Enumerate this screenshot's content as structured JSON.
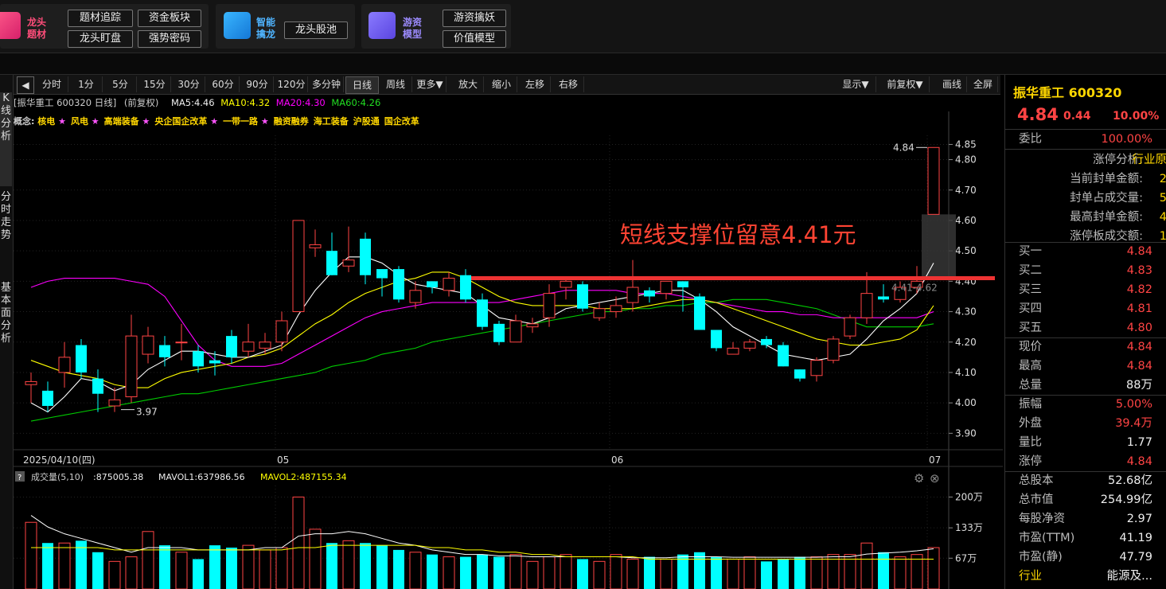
{
  "promo": {
    "g1": {
      "title1": "龙头",
      "title2": "题材",
      "buttons": [
        "题材追踪",
        "资金板块",
        "龙头盯盘",
        "强势密码"
      ]
    },
    "g2": {
      "title1": "智能",
      "title2": "擒龙",
      "buttons": [
        "龙头股池"
      ]
    },
    "g3": {
      "title1": "游资",
      "title2": "模型",
      "buttons": [
        "游资擒妖",
        "价值模型"
      ]
    }
  },
  "left_tabs": [
    "K线分析",
    "分时走势",
    "基本面分析"
  ],
  "toolbar": {
    "periods": [
      "分时",
      "1分",
      "5分",
      "15分",
      "30分",
      "60分",
      "90分",
      "120分",
      "多分钟",
      "日线",
      "周线",
      "更多▼"
    ],
    "active": "日线",
    "actions": [
      "放大",
      "缩小",
      "左移",
      "右移"
    ],
    "right": [
      "显示▼",
      "前复权▼",
      "画线",
      "全屏"
    ]
  },
  "info": {
    "stock": "[振华重工 600320 日线]",
    "adjust": "(前复权)",
    "ma5": "MA5:4.46",
    "ma10": "MA10:4.32",
    "ma20": "MA20:4.30",
    "ma60": "MA60:4.26"
  },
  "concept_label": "概念:",
  "concepts": [
    {
      "name": "核电",
      "star": true
    },
    {
      "name": "风电",
      "star": true
    },
    {
      "name": "高端装备",
      "star": true
    },
    {
      "name": "央企国企改革",
      "star": true
    },
    {
      "name": "一带一路",
      "star": true
    },
    {
      "name": "融资融券",
      "star": false
    },
    {
      "name": "海工装备",
      "star": false
    },
    {
      "name": "沪股通",
      "star": false
    },
    {
      "name": "国企改革",
      "star": false
    }
  ],
  "annotation": "短线支撑位留意4.41元",
  "labels": {
    "high": "4.84",
    "low": "3.97",
    "band": "4.41-4.62",
    "date_first": "2025/04/10(四)",
    "months": [
      "05",
      "06",
      "07"
    ]
  },
  "chart_data": [
    {
      "type": "candlestick",
      "title": "振华重工 600320 日线",
      "ylim": [
        3.88,
        4.88
      ],
      "yticks": [
        4.85,
        4.8,
        4.7,
        4.6,
        4.5,
        4.4,
        4.3,
        4.2,
        4.1,
        4.0,
        3.9
      ],
      "support_line": 4.41,
      "candles": [
        {
          "o": 4.06,
          "c": 4.07,
          "h": 4.1,
          "l": 4.0
        },
        {
          "o": 4.04,
          "c": 3.99,
          "h": 4.07,
          "l": 3.97
        },
        {
          "o": 4.1,
          "c": 4.15,
          "h": 4.2,
          "l": 4.05
        },
        {
          "o": 4.19,
          "c": 4.1,
          "h": 4.21,
          "l": 4.08
        },
        {
          "o": 4.08,
          "c": 4.03,
          "h": 4.11,
          "l": 3.97
        },
        {
          "o": 3.99,
          "c": 4.01,
          "h": 4.05,
          "l": 3.97
        },
        {
          "o": 4.02,
          "c": 4.22,
          "h": 4.29,
          "l": 4.0
        },
        {
          "o": 4.16,
          "c": 4.22,
          "h": 4.25,
          "l": 4.13
        },
        {
          "o": 4.19,
          "c": 4.15,
          "h": 4.22,
          "l": 4.12
        },
        {
          "o": 4.2,
          "c": 4.2,
          "h": 4.26,
          "l": 4.14
        },
        {
          "o": 4.17,
          "c": 4.12,
          "h": 4.19,
          "l": 4.1
        },
        {
          "o": 4.14,
          "c": 4.13,
          "h": 4.17,
          "l": 4.09
        },
        {
          "o": 4.22,
          "c": 4.15,
          "h": 4.24,
          "l": 4.13
        },
        {
          "o": 4.17,
          "c": 4.2,
          "h": 4.26,
          "l": 4.15
        },
        {
          "o": 4.18,
          "c": 4.2,
          "h": 4.23,
          "l": 4.16
        },
        {
          "o": 4.2,
          "c": 4.27,
          "h": 4.3,
          "l": 4.17
        },
        {
          "o": 4.3,
          "c": 4.6,
          "h": 4.6,
          "l": 4.3
        },
        {
          "o": 4.51,
          "c": 4.52,
          "h": 4.57,
          "l": 4.48
        },
        {
          "o": 4.5,
          "c": 4.42,
          "h": 4.56,
          "l": 4.42
        },
        {
          "o": 4.45,
          "c": 4.47,
          "h": 4.58,
          "l": 4.43
        },
        {
          "o": 4.54,
          "c": 4.42,
          "h": 4.56,
          "l": 4.39
        },
        {
          "o": 4.44,
          "c": 4.41,
          "h": 4.44,
          "l": 4.35
        },
        {
          "o": 4.44,
          "c": 4.34,
          "h": 4.45,
          "l": 4.33
        },
        {
          "o": 4.33,
          "c": 4.37,
          "h": 4.4,
          "l": 4.31
        },
        {
          "o": 4.4,
          "c": 4.38,
          "h": 4.4,
          "l": 4.36
        },
        {
          "o": 4.37,
          "c": 4.41,
          "h": 4.43,
          "l": 4.35
        },
        {
          "o": 4.42,
          "c": 4.34,
          "h": 4.44,
          "l": 4.33
        },
        {
          "o": 4.34,
          "c": 4.25,
          "h": 4.36,
          "l": 4.24
        },
        {
          "o": 4.26,
          "c": 4.2,
          "h": 4.27,
          "l": 4.19
        },
        {
          "o": 4.2,
          "c": 4.27,
          "h": 4.29,
          "l": 4.2
        },
        {
          "o": 4.25,
          "c": 4.26,
          "h": 4.28,
          "l": 4.23
        },
        {
          "o": 4.28,
          "c": 4.36,
          "h": 4.39,
          "l": 4.25
        },
        {
          "o": 4.38,
          "c": 4.4,
          "h": 4.41,
          "l": 4.34
        },
        {
          "o": 4.39,
          "c": 4.31,
          "h": 4.4,
          "l": 4.3
        },
        {
          "o": 4.28,
          "c": 4.31,
          "h": 4.33,
          "l": 4.27
        },
        {
          "o": 4.3,
          "c": 4.32,
          "h": 4.35,
          "l": 4.28
        },
        {
          "o": 4.33,
          "c": 4.38,
          "h": 4.47,
          "l": 4.3
        },
        {
          "o": 4.37,
          "c": 4.35,
          "h": 4.38,
          "l": 4.33
        },
        {
          "o": 4.36,
          "c": 4.4,
          "h": 4.4,
          "l": 4.34
        },
        {
          "o": 4.4,
          "c": 4.38,
          "h": 4.4,
          "l": 4.3
        },
        {
          "o": 4.35,
          "c": 4.24,
          "h": 4.36,
          "l": 4.24
        },
        {
          "o": 4.24,
          "c": 4.18,
          "h": 4.24,
          "l": 4.17
        },
        {
          "o": 4.16,
          "c": 4.18,
          "h": 4.2,
          "l": 4.16
        },
        {
          "o": 4.18,
          "c": 4.2,
          "h": 4.21,
          "l": 4.17
        },
        {
          "o": 4.21,
          "c": 4.19,
          "h": 4.22,
          "l": 4.18
        },
        {
          "o": 4.19,
          "c": 4.12,
          "h": 4.2,
          "l": 4.12
        },
        {
          "o": 4.11,
          "c": 4.08,
          "h": 4.11,
          "l": 4.07
        },
        {
          "o": 4.09,
          "c": 4.14,
          "h": 4.15,
          "l": 4.07
        },
        {
          "o": 4.14,
          "c": 4.21,
          "h": 4.22,
          "l": 4.13
        },
        {
          "o": 4.22,
          "c": 4.28,
          "h": 4.29,
          "l": 4.21
        },
        {
          "o": 4.28,
          "c": 4.36,
          "h": 4.43,
          "l": 4.26
        },
        {
          "o": 4.35,
          "c": 4.34,
          "h": 4.39,
          "l": 4.33
        },
        {
          "o": 4.34,
          "c": 4.38,
          "h": 4.4,
          "l": 4.33
        },
        {
          "o": 4.38,
          "c": 4.4,
          "h": 4.45,
          "l": 4.36
        },
        {
          "o": 4.62,
          "c": 4.84,
          "h": 4.84,
          "l": 4.62
        }
      ],
      "ma5": [
        4.0,
        3.97,
        4.02,
        4.08,
        4.07,
        4.04,
        4.06,
        4.11,
        4.14,
        4.17,
        4.17,
        4.16,
        4.15,
        4.15,
        4.17,
        4.19,
        4.29,
        4.37,
        4.43,
        4.48,
        4.48,
        4.46,
        4.42,
        4.39,
        4.38,
        4.37,
        4.36,
        4.32,
        4.28,
        4.27,
        4.26,
        4.28,
        4.31,
        4.32,
        4.33,
        4.34,
        4.35,
        4.36,
        4.37,
        4.37,
        4.34,
        4.3,
        4.25,
        4.22,
        4.19,
        4.16,
        4.15,
        4.14,
        4.15,
        4.16,
        4.21,
        4.27,
        4.31,
        4.36,
        4.46
      ],
      "ma10": [
        4.14,
        4.12,
        4.1,
        4.09,
        4.08,
        4.06,
        4.05,
        4.05,
        4.08,
        4.1,
        4.11,
        4.12,
        4.13,
        4.15,
        4.16,
        4.18,
        4.22,
        4.26,
        4.29,
        4.33,
        4.36,
        4.38,
        4.4,
        4.41,
        4.43,
        4.43,
        4.41,
        4.38,
        4.35,
        4.33,
        4.32,
        4.32,
        4.32,
        4.32,
        4.31,
        4.31,
        4.31,
        4.32,
        4.33,
        4.34,
        4.34,
        4.33,
        4.31,
        4.29,
        4.27,
        4.25,
        4.23,
        4.21,
        4.2,
        4.19,
        4.19,
        4.2,
        4.21,
        4.24,
        4.32
      ],
      "ma20": [
        4.38,
        4.4,
        4.41,
        4.41,
        4.41,
        4.41,
        4.4,
        4.39,
        4.35,
        4.27,
        4.19,
        4.14,
        4.12,
        4.12,
        4.12,
        4.13,
        4.16,
        4.19,
        4.22,
        4.25,
        4.28,
        4.3,
        4.31,
        4.32,
        4.33,
        4.33,
        4.33,
        4.33,
        4.33,
        4.34,
        4.35,
        4.36,
        4.37,
        4.37,
        4.37,
        4.37,
        4.36,
        4.36,
        4.36,
        4.35,
        4.34,
        4.33,
        4.32,
        4.31,
        4.3,
        4.3,
        4.29,
        4.29,
        4.28,
        4.28,
        4.28,
        4.28,
        4.28,
        4.28,
        4.3
      ],
      "ma60": [
        3.94,
        3.95,
        3.96,
        3.97,
        3.98,
        3.99,
        4.0,
        4.01,
        4.02,
        4.03,
        4.03,
        4.04,
        4.05,
        4.06,
        4.07,
        4.08,
        4.09,
        4.1,
        4.12,
        4.13,
        4.14,
        4.16,
        4.17,
        4.18,
        4.2,
        4.21,
        4.22,
        4.23,
        4.24,
        4.25,
        4.26,
        4.27,
        4.28,
        4.29,
        4.3,
        4.3,
        4.31,
        4.31,
        4.32,
        4.32,
        4.33,
        4.33,
        4.34,
        4.34,
        4.34,
        4.33,
        4.32,
        4.31,
        4.29,
        4.27,
        4.25,
        4.25,
        4.25,
        4.25,
        4.26
      ]
    },
    {
      "type": "bar",
      "title": "成交量(5,10)",
      "values_label": ":875005.38",
      "mavol1_label": "MAVOL1:637986.56",
      "mavol2_label": "MAVOL2:487155.34",
      "ylim": [
        0,
        2250000
      ],
      "yticks": [
        "200万",
        "133万",
        "67万"
      ],
      "volumes": [
        1450000,
        1000000,
        1000000,
        1050000,
        800000,
        600000,
        700000,
        1250000,
        950000,
        800000,
        650000,
        950000,
        900000,
        950000,
        850000,
        900000,
        2000000,
        1300000,
        1000000,
        1050000,
        1000000,
        950000,
        850000,
        800000,
        750000,
        700000,
        700000,
        750000,
        700000,
        750000,
        600000,
        700000,
        750000,
        650000,
        600000,
        750000,
        650000,
        700000,
        650000,
        750000,
        800000,
        700000,
        650000,
        700000,
        600000,
        650000,
        700000,
        700000,
        750000,
        750000,
        1000000,
        800000,
        700000,
        750000,
        900000
      ],
      "mavol1": [
        1600000,
        1350000,
        1200000,
        1100000,
        1000000,
        900000,
        800000,
        900000,
        900000,
        900000,
        850000,
        850000,
        850000,
        850000,
        900000,
        900000,
        1150000,
        1200000,
        1200000,
        1250000,
        1200000,
        1100000,
        1000000,
        950000,
        850000,
        800000,
        750000,
        750000,
        720000,
        720000,
        700000,
        700000,
        700000,
        700000,
        700000,
        700000,
        680000,
        680000,
        680000,
        700000,
        700000,
        700000,
        690000,
        690000,
        690000,
        690000,
        690000,
        690000,
        700000,
        700000,
        760000,
        780000,
        800000,
        830000,
        875000
      ],
      "mavol2": [
        900000,
        900000,
        900000,
        900000,
        900000,
        850000,
        850000,
        850000,
        850000,
        850000,
        850000,
        850000,
        850000,
        850000,
        850000,
        850000,
        900000,
        900000,
        950000,
        950000,
        950000,
        950000,
        950000,
        950000,
        900000,
        900000,
        850000,
        850000,
        800000,
        800000,
        750000,
        750000,
        700000,
        700000,
        700000,
        700000,
        700000,
        650000,
        650000,
        650000,
        650000,
        650000,
        650000,
        650000,
        650000,
        650000,
        650000,
        650000,
        650000,
        650000,
        650000,
        650000,
        650000,
        650000,
        650000
      ]
    }
  ],
  "right_panel": {
    "title": "振华重工 600320",
    "price": "4.84",
    "change": "0.44",
    "change_pct": "10.00%",
    "weibi_label": "委比",
    "weibi": "100.00%",
    "limit_rows": [
      {
        "label": "涨停分析:",
        "value": "行业原"
      },
      {
        "label": "当前封单金额:",
        "value": "2"
      },
      {
        "label": "封单占成交量:",
        "value": "5"
      },
      {
        "label": "最高封单金额:",
        "value": "4"
      },
      {
        "label": "涨停板成交额:",
        "value": "1"
      }
    ],
    "bids": [
      {
        "label": "买一",
        "value": "4.84"
      },
      {
        "label": "买二",
        "value": "4.83"
      },
      {
        "label": "买三",
        "value": "4.82"
      },
      {
        "label": "买四",
        "value": "4.81"
      },
      {
        "label": "买五",
        "value": "4.80"
      }
    ],
    "quotes": [
      {
        "label": "现价",
        "value": "4.84",
        "color": "red"
      },
      {
        "label": "最高",
        "value": "4.84",
        "color": "red"
      },
      {
        "label": "总量",
        "value": "88万",
        "color": "white"
      }
    ],
    "quotes2": [
      {
        "label": "振幅",
        "value": "5.00%",
        "color": "red"
      },
      {
        "label": "外盘",
        "value": "39.4万",
        "color": "red"
      },
      {
        "label": "量比",
        "value": "1.77",
        "color": "white"
      },
      {
        "label": "涨停",
        "value": "4.84",
        "color": "red"
      }
    ],
    "fundamentals": [
      {
        "label": "总股本",
        "value": "52.68亿"
      },
      {
        "label": "总市值",
        "value": "254.99亿"
      },
      {
        "label": "每股净资",
        "value": "2.97"
      },
      {
        "label": "市盈(TTM)",
        "value": "41.19"
      },
      {
        "label": "市盈(静)",
        "value": "47.79"
      },
      {
        "label": "行业",
        "value": "能源及..."
      }
    ]
  },
  "colors": {
    "up": "#ff4444",
    "down": "#00ffff",
    "ma5": "#ffffff",
    "ma10": "#ffff00",
    "ma20": "#ff00ff",
    "ma60": "#00cc00",
    "support": "#ee3333",
    "annotation": "#ff4433"
  }
}
